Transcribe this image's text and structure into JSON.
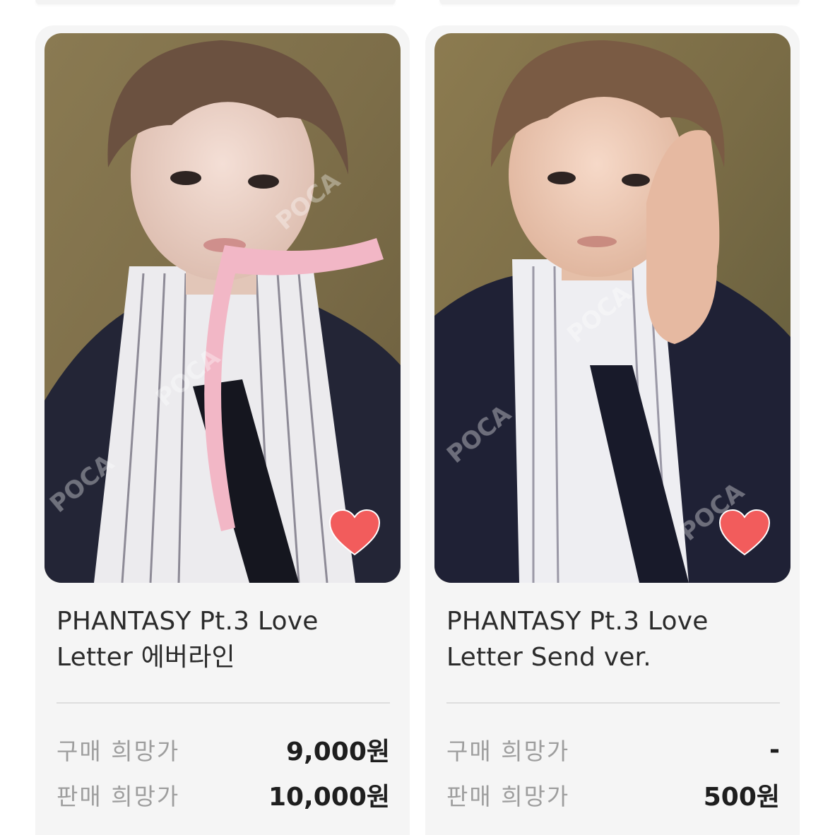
{
  "listings": [
    {
      "title": "PHANTASY Pt.3 Love Letter 에버라인",
      "buy_label": "구매 희망가",
      "buy_price": "9,000원",
      "sell_label": "판매 희망가",
      "sell_price": "10,000원",
      "favorited": true,
      "image_icon": "photocard-image"
    },
    {
      "title": "PHANTASY Pt.3 Love Letter Send ver.",
      "buy_label": "구매 희망가",
      "buy_price": "-",
      "sell_label": "판매 희망가",
      "sell_price": "500원",
      "favorited": true,
      "image_icon": "photocard-image"
    }
  ],
  "colors": {
    "card_background": "#f5f5f5",
    "heart": "#f25c5c",
    "label": "#9e9e9e",
    "value": "#1e1e1e"
  }
}
